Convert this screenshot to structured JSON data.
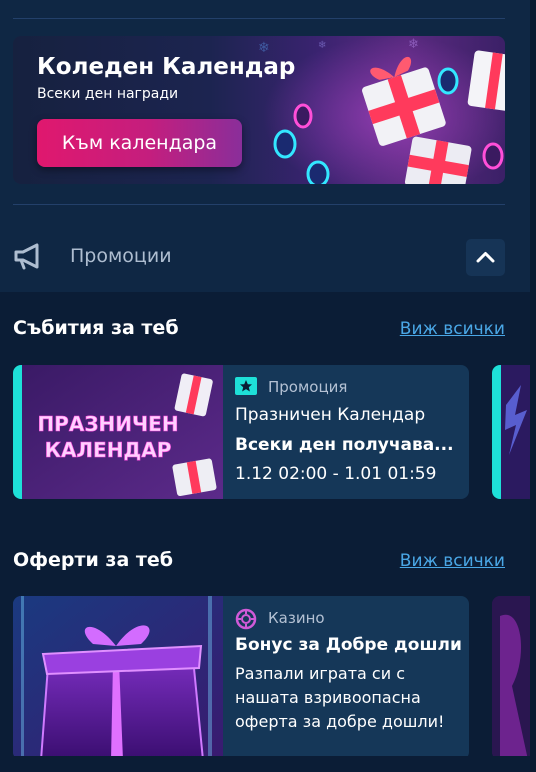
{
  "banner": {
    "title": "Коледен Календар",
    "subtitle": "Всеки ден награди",
    "button_label": "Към календара"
  },
  "promotions": {
    "label": "Промоции",
    "icon": "megaphone-icon",
    "toggle_icon": "chevron-up-icon"
  },
  "events": {
    "title": "Събития за теб",
    "see_all": "Виж всички",
    "cards": [
      {
        "thumb_text_line1": "ПРАЗНИЧЕН",
        "thumb_text_line2": "КАЛЕНДАР",
        "tag": "Промоция",
        "tag_icon": "star-icon",
        "title": "Празничен Календар",
        "subtitle": "Всеки ден получава...",
        "dates": "1.12 02:00 - 1.01 01:59"
      }
    ]
  },
  "offers": {
    "title": "Оферти за теб",
    "see_all": "Виж всички",
    "cards": [
      {
        "tag": "Казино",
        "tag_icon": "casino-chip-icon",
        "title": "Бонус за Добре дошли",
        "description": "Разпали играта си с нашата взривоопасна оферта за добре дошли!"
      }
    ]
  },
  "colors": {
    "background": "#0b1d36",
    "panel": "#0f2744",
    "card": "#153758",
    "accent_cyan": "#1ee0d8",
    "link": "#4aa7e6",
    "button_pink": "#e0186e",
    "button_purple": "#8a2e9a"
  }
}
